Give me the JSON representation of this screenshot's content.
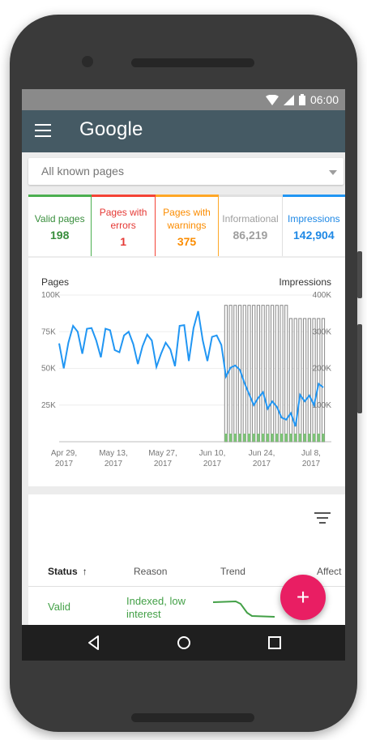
{
  "status_bar": {
    "time": "06:00"
  },
  "app_bar": {
    "title": "Google"
  },
  "filter": {
    "selected": "All known pages"
  },
  "metrics": [
    {
      "label": "Valid pages",
      "value": "198",
      "color": "#388e3c"
    },
    {
      "label": "Pages with errors",
      "value": "1",
      "color": "#e53935"
    },
    {
      "label": "Pages with warnings",
      "value": "375",
      "color": "#fb8c00"
    },
    {
      "label": "Informational",
      "value": "86,219",
      "color": "#9e9e9e"
    },
    {
      "label": "Impressions",
      "value": "142,904",
      "color": "#1e88e5"
    }
  ],
  "chart_data": {
    "type": "line",
    "left_axis_title": "Pages",
    "right_axis_title": "Impressions",
    "left_ticks": [
      "100K",
      "75K",
      "50K",
      "25K"
    ],
    "right_ticks": [
      "400K",
      "300K",
      "200K",
      "100K"
    ],
    "x_ticks": [
      {
        "line1": "Apr 29,",
        "line2": "2017"
      },
      {
        "line1": "May 13,",
        "line2": "2017"
      },
      {
        "line1": "May 27,",
        "line2": "2017"
      },
      {
        "line1": "Jun 10,",
        "line2": "2017"
      },
      {
        "line1": "Jun 24,",
        "line2": "2017"
      },
      {
        "line1": "Jul 8,",
        "line2": "2017"
      }
    ],
    "ylim_left": [
      0,
      100000
    ],
    "ylim_right": [
      0,
      400000
    ],
    "series": [
      {
        "axis": "right",
        "color": "#2196f3",
        "values": [
          268000,
          200000,
          270000,
          316000,
          300000,
          240000,
          308000,
          310000,
          276000,
          230000,
          308000,
          304000,
          250000,
          244000,
          290000,
          300000,
          266000,
          212000,
          260000,
          292000,
          276000,
          204000,
          240000,
          270000,
          252000,
          206000,
          316000,
          318000,
          220000,
          310000,
          356000,
          276000,
          220000,
          286000,
          290000,
          264000,
          178000,
          202000,
          208000,
          196000,
          160000,
          130000,
          100000,
          120000,
          135000,
          90000,
          110000,
          95000,
          66000,
          60000,
          78000,
          42000,
          128000,
          110000,
          126000,
          100000,
          158000,
          148000
        ]
      }
    ],
    "bars": {
      "axis": "left",
      "start_index": 36,
      "values": [
        93000,
        93000,
        93000,
        93000,
        93000,
        93000,
        93000,
        93000,
        93000,
        93000,
        93000,
        93000,
        93000,
        93000,
        84000,
        84000,
        84000,
        84000,
        84000,
        84000,
        84000,
        84000
      ]
    },
    "grid": true
  },
  "table": {
    "columns": {
      "status": "Status",
      "reason": "Reason",
      "trend": "Trend",
      "affected": "Affect"
    },
    "rows": [
      {
        "status": "Valid",
        "reason": "Indexed, low interest"
      }
    ]
  },
  "fab": {
    "label": "+"
  },
  "colors": {
    "appbar": "#455a64",
    "fab": "#e91e63",
    "valid": "#43a047"
  }
}
